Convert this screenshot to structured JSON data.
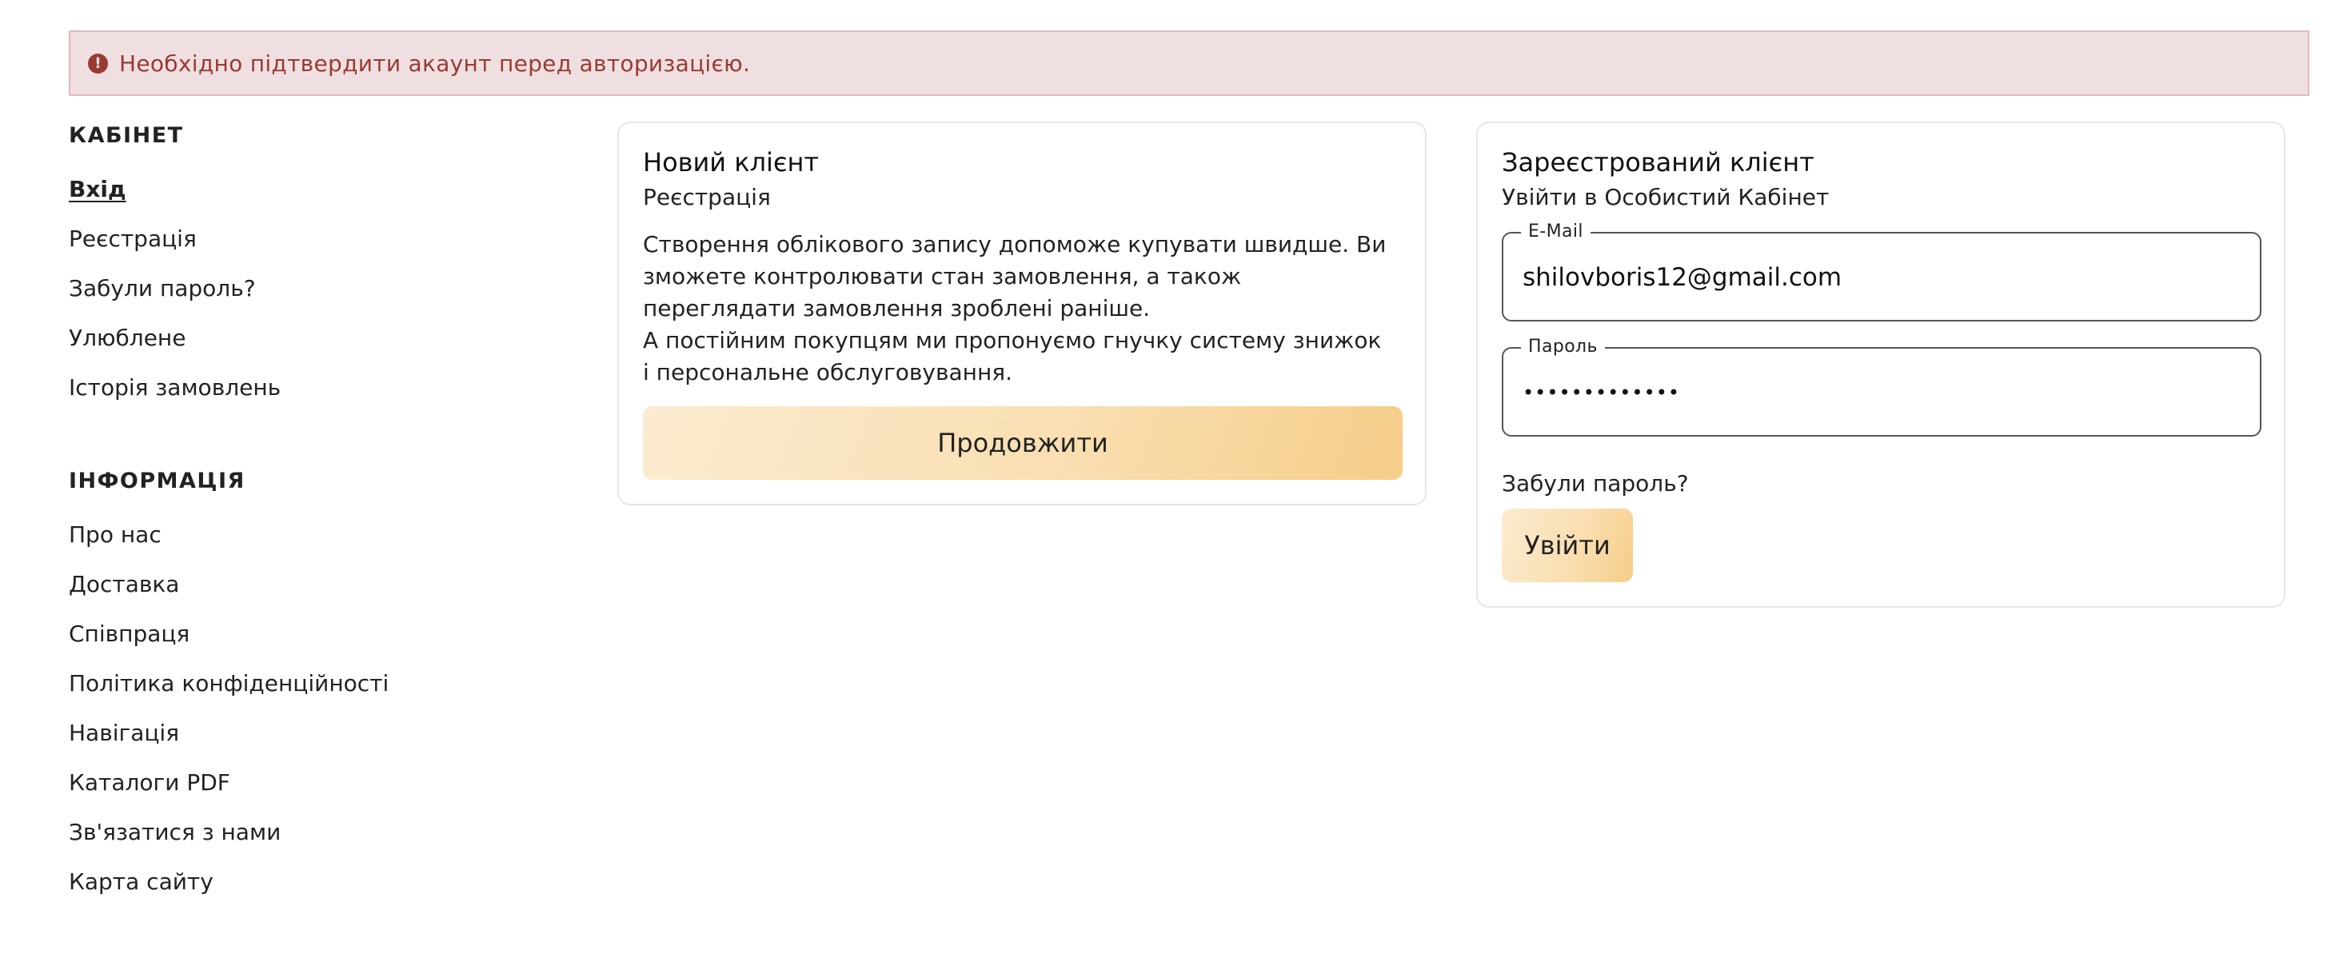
{
  "alert": {
    "icon": "exclamation-circle-icon",
    "text": "Необхідно підтвердити акаунт перед авторизацією.",
    "color": "#9a3a34",
    "background": "#efdfe0"
  },
  "sidebar": {
    "cabinet_heading": "КАБІНЕТ",
    "cabinet_items": [
      {
        "label": "Вхід",
        "active": true
      },
      {
        "label": "Реєстрація"
      },
      {
        "label": "Забули пароль?"
      },
      {
        "label": "Улюблене"
      },
      {
        "label": "Історія замовлень"
      }
    ],
    "info_heading": "ІНФОРМАЦІЯ",
    "info_items": [
      {
        "label": "Про нас"
      },
      {
        "label": "Доставка"
      },
      {
        "label": "Співпраця"
      },
      {
        "label": "Політика конфіденційності"
      },
      {
        "label": "Навігація"
      },
      {
        "label": "Каталоги PDF"
      },
      {
        "label": "Зв'язатися з нами"
      },
      {
        "label": "Карта сайту"
      }
    ]
  },
  "new_client": {
    "title": "Новий клієнт",
    "subtitle": "Реєстрація",
    "paragraph1": "Створення облікового запису допоможе купувати швидше. Ви зможете контролювати стан замовлення, а також переглядати замовлення зроблені раніше.",
    "paragraph2": "А постійним покупцям ми пропонуємо гнучку систему знижок і персональне обслуговування.",
    "continue_label": "Продовжити"
  },
  "login": {
    "title": "Зареєстрований клієнт",
    "subtitle": "Увійти в Особистий Кабінет",
    "email_label": "E-Mail",
    "email_value": "shilovboris12@gmail.com",
    "password_label": "Пароль",
    "password_value": "•••••••••••••",
    "forgot_label": "Забули пароль?",
    "login_label": "Увійти"
  },
  "colors": {
    "accent_gradient_start": "#fbebd0",
    "accent_gradient_end": "#f6cd88",
    "alert_text": "#9a3a34"
  }
}
